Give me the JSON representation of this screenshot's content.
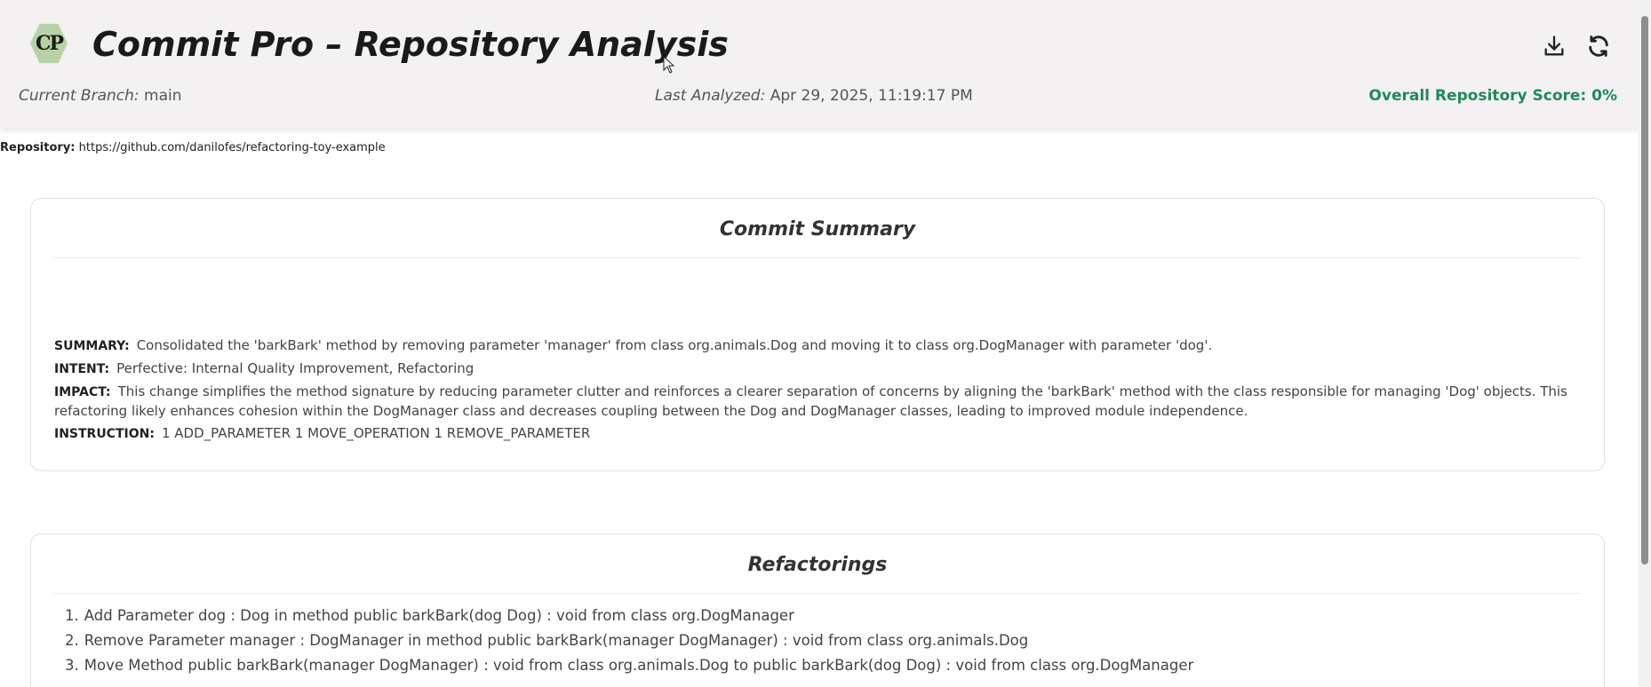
{
  "header": {
    "logo_text": "CP",
    "title": "Commit Pro – Repository Analysis",
    "branch_label": "Current Branch:",
    "branch_value": "main",
    "analyzed_label": "Last Analyzed:",
    "analyzed_value": "Apr 29, 2025, 11:19:17 PM",
    "score_text": "Overall Repository Score: 0%",
    "download_icon": "download-icon",
    "refresh_icon": "refresh-icon"
  },
  "repository": {
    "label": "Repository:",
    "url": "https://github.com/danilofes/refactoring-toy-example"
  },
  "commit_summary": {
    "title": "Commit Summary",
    "summary_key": "SUMMARY:",
    "summary_value": "Consolidated the 'barkBark' method by removing parameter 'manager' from class org.animals.Dog and moving it to class org.DogManager with parameter 'dog'.",
    "intent_key": "INTENT:",
    "intent_value": "Perfective: Internal Quality Improvement, Refactoring",
    "impact_key": "IMPACT:",
    "impact_value": "This change simplifies the method signature by reducing parameter clutter and reinforces a clearer separation of concerns by aligning the 'barkBark' method with the class responsible for managing 'Dog' objects. This refactoring likely enhances cohesion within the DogManager class and decreases coupling between the Dog and DogManager classes, leading to improved module independence.",
    "instruction_key": "INSTRUCTION:",
    "instruction_value": "1 ADD_PARAMETER 1 MOVE_OPERATION 1 REMOVE_PARAMETER"
  },
  "refactorings": {
    "title": "Refactorings",
    "items": [
      {
        "num": "1.",
        "text": "Add Parameter dog : Dog in method public barkBark(dog Dog) : void from class org.DogManager"
      },
      {
        "num": "2.",
        "text": "Remove Parameter manager : DogManager in method public barkBark(manager DogManager) : void from class org.animals.Dog"
      },
      {
        "num": "3.",
        "text": "Move Method public barkBark(manager DogManager) : void from class org.animals.Dog to public barkBark(dog Dog) : void from class org.DogManager"
      }
    ]
  },
  "colors": {
    "header_bg": "#f3f1f2",
    "score_green": "#1f8a5a",
    "logo_green": "#b7d3a5"
  }
}
